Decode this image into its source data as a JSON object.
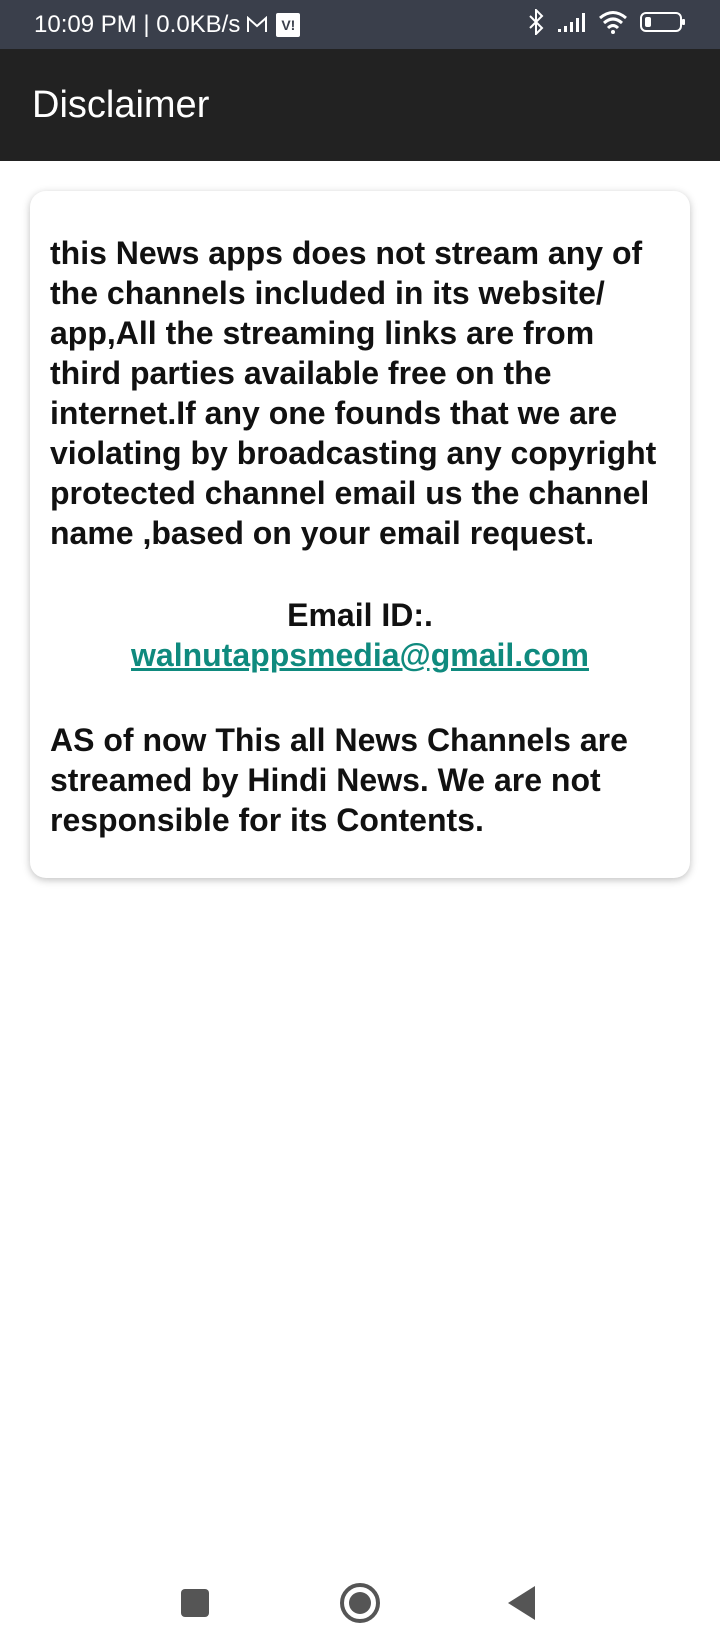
{
  "status_bar": {
    "time_speed": "10:09 PM | 0.0KB/s",
    "carrier_badge": "V!",
    "icons": [
      "mail-icon",
      "bluetooth-icon",
      "signal-icon",
      "wifi-icon",
      "battery-icon"
    ]
  },
  "app_bar": {
    "title": "Disclaimer"
  },
  "card": {
    "paragraph1": "this News apps does not stream any of the channels included in its website/ app,All the streaming links are from third parties available free on the internet.If any one founds that we are violating by broadcasting any copyright protected channel email us the channel name ,based on your email request.",
    "email_label": "Email ID:.",
    "email_address": "walnutappsmedia@gmail.com",
    "paragraph2": "AS of now This all  News Channels are streamed by Hindi News. We are not responsible for its Contents."
  },
  "colors": {
    "status_bar": "#3a3f4b",
    "app_bar": "#222222",
    "link": "#0f8a7e",
    "nav_icons": "#555555"
  },
  "nav_bar": {
    "buttons": [
      "recents-square-icon",
      "home-circle-icon",
      "back-triangle-icon"
    ]
  }
}
